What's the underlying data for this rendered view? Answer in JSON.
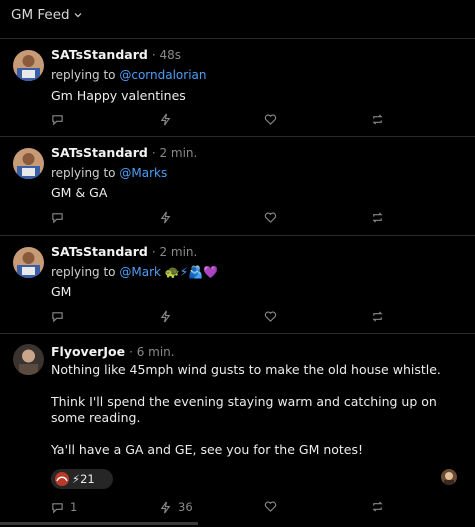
{
  "header": {
    "title": "GM Feed"
  },
  "posts": [
    {
      "author": "SATsStandard",
      "time": "· 48s",
      "reply_prefix": "replying to",
      "reply_to": "@corndalorian",
      "paragraphs": [
        "Gm Happy valentines"
      ]
    },
    {
      "author": "SATsStandard",
      "time": "· 2 min.",
      "reply_prefix": "replying to",
      "reply_to": "@Marks",
      "paragraphs": [
        "GM & GA"
      ]
    },
    {
      "author": "SATsStandard",
      "time": "· 2 min.",
      "reply_prefix": "replying to",
      "reply_to": "@Mark 🐢⚡🫂💜",
      "paragraphs": [
        "GM"
      ]
    },
    {
      "author": "FlyoverJoe",
      "time": "· 6 min.",
      "paragraphs": [
        "Nothing like 45mph wind gusts to make the old house whistle.",
        "Think I'll spend the evening staying warm and catching up on some reading.",
        "Ya'll have a GA and GE, see you for the GM notes!"
      ],
      "zap_total": "⚡21",
      "reply_count": "1",
      "zap_count": "36"
    }
  ],
  "icons": {
    "reply": "reply-icon",
    "zap": "zap-icon",
    "like": "heart-icon",
    "repost": "repost-icon"
  },
  "colors": {
    "background": "#000000",
    "mention": "#4e9df5",
    "muted": "#8a8a8a",
    "divider": "#2a2a2a"
  }
}
